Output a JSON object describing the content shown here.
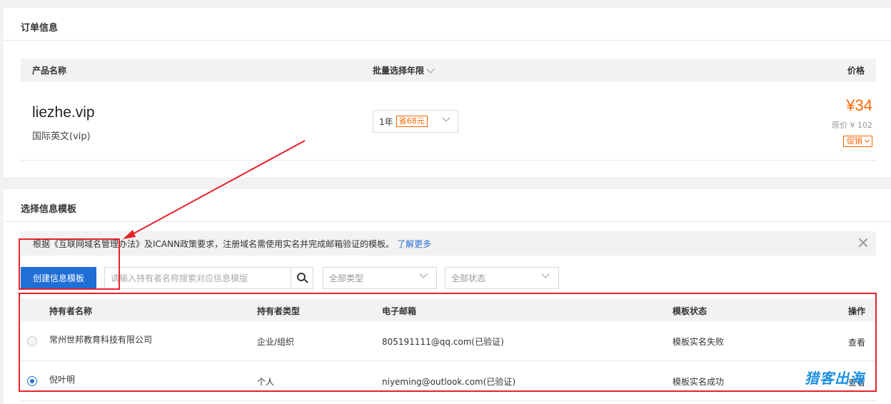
{
  "order": {
    "title": "订单信息",
    "headers": {
      "product": "产品名称",
      "period": "批量选择年限",
      "price": "价格"
    },
    "item": {
      "domain": "liezhe.vip",
      "subtitle": "国际英文(vip)",
      "period_value": "1年",
      "save_tag": "省68元",
      "price": "¥34",
      "original_price": "原价 ¥ 102",
      "promo_label": "促销"
    }
  },
  "template": {
    "title": "选择信息模板",
    "notice": {
      "text": "根据《互联网域名管理办法》及ICANN政策要求，注册域名需使用实名并完成邮箱验证的模板。",
      "link": "了解更多"
    },
    "toolbar": {
      "create_label": "创建信息模板",
      "search_placeholder": "请输入持有者名称搜索对应信息模版",
      "type_filter": "全部类型",
      "status_filter": "全部状态"
    },
    "columns": {
      "name": "持有者名称",
      "type": "持有者类型",
      "email": "电子邮箱",
      "status": "模板状态",
      "op": "操作"
    },
    "rows": [
      {
        "name": "常州世邦教育科技有限公司",
        "type": "企业/组织",
        "email": "805191111@qq.com(已验证)",
        "status": "模板实名失败",
        "op": "查看",
        "selected": false
      },
      {
        "name": "倪叶明",
        "type": "个人",
        "email": "niyeming@outlook.com(已验证)",
        "status": "模板实名成功",
        "op": "查看",
        "selected": true
      }
    ]
  },
  "watermark": "猎客出海",
  "colors": {
    "accent": "#1f6fd6",
    "price": "#ff6600",
    "annotation": "#e8212b"
  },
  "icons": [
    "chevron-down-icon",
    "search-icon",
    "close-icon",
    "radio-icon",
    "arrow-annotation"
  ]
}
